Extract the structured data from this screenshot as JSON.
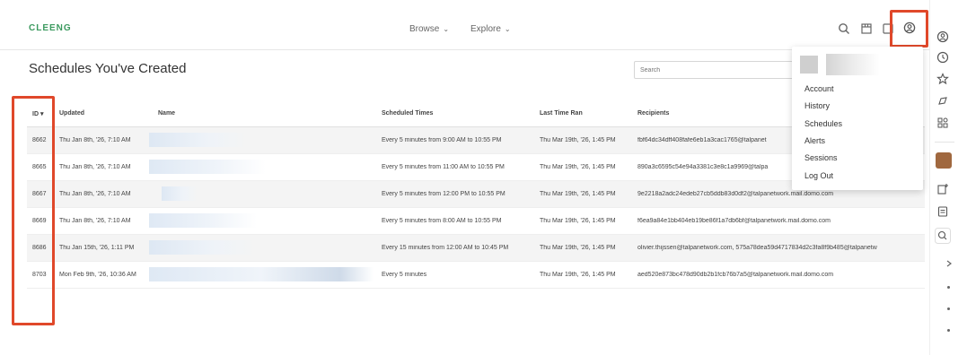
{
  "brand": {
    "logo": "CLEENG"
  },
  "nav": {
    "browse": "Browse",
    "explore": "Explore"
  },
  "icons": {
    "search": "search-icon",
    "store": "store-icon",
    "notes": "notes-icon",
    "profile": "user-circle-icon"
  },
  "page": {
    "title": "Schedules You've Created"
  },
  "search": {
    "placeholder": "Search"
  },
  "table": {
    "columns": {
      "id": "ID ▾",
      "updated": "Updated",
      "name": "Name",
      "times": "Scheduled Times",
      "last_ran": "Last Time Ran",
      "recipients": "Recipients"
    },
    "rows": [
      {
        "id": "8662",
        "updated": "Thu Jan 8th, '26, 7:10 AM",
        "times": "Every 5 minutes from 9:00 AM to 10:55 PM",
        "last_ran": "Thu Mar 19th, '26, 1:45 PM",
        "recipients": "fbf64dc34dff408fafe6eb1a3cac1765@talpanet"
      },
      {
        "id": "8665",
        "updated": "Thu Jan 8th, '26, 7:10 AM",
        "times": "Every 5 minutes from 11:00 AM to 10:55 PM",
        "last_ran": "Thu Mar 19th, '26, 1:45 PM",
        "recipients": "890a3c6595c54e94a3381c3e8c1a9969@talpa"
      },
      {
        "id": "8667",
        "updated": "Thu Jan 8th, '26, 7:10 AM",
        "times": "Every 5 minutes from 12:00 PM to 10:55 PM",
        "last_ran": "Thu Mar 19th, '26, 1:45 PM",
        "recipients": "9e2218a2adc24edeb27cb5ddb83d0df2@talpanetwork.mail.domo.com"
      },
      {
        "id": "8669",
        "updated": "Thu Jan 8th, '26, 7:10 AM",
        "times": "Every 5 minutes from 8:00 AM to 10:55 PM",
        "last_ran": "Thu Mar 19th, '26, 1:45 PM",
        "recipients": "f6ea9a84e1bb404eb19be86f1a7db6bf@talpanetwork.mail.domo.com"
      },
      {
        "id": "8686",
        "updated": "Thu Jan 15th, '26, 1:11 PM",
        "times": "Every 15 minutes from 12:00 AM to 10:45 PM",
        "last_ran": "Thu Mar 19th, '26, 1:45 PM",
        "recipients": "olivier.thijssen@talpanetwork.com, 575a78dea59d4717834d2c3fa8f9b485@talpanetw"
      },
      {
        "id": "8703",
        "updated": "Mon Feb 9th, '26, 10:36 AM",
        "times": "Every 5 minutes",
        "last_ran": "Thu Mar 19th, '26, 1:45 PM",
        "recipients": "aed520e873bc478d90db2b1fcb76b7a5@talpanetwork.mail.domo.com"
      }
    ]
  },
  "menu": {
    "items": [
      "Account",
      "History",
      "Schedules",
      "Alerts",
      "Sessions",
      "Log Out"
    ]
  },
  "rail_icons": [
    "user-circle-icon",
    "clock-icon",
    "star-icon",
    "compass-icon",
    "apps-icon",
    "avatar",
    "add-note-icon",
    "clipboard-icon",
    "search-icon",
    "chevron-right-icon"
  ],
  "colors": {
    "highlight": "#e0482a",
    "logo": "#3c9a5f"
  }
}
